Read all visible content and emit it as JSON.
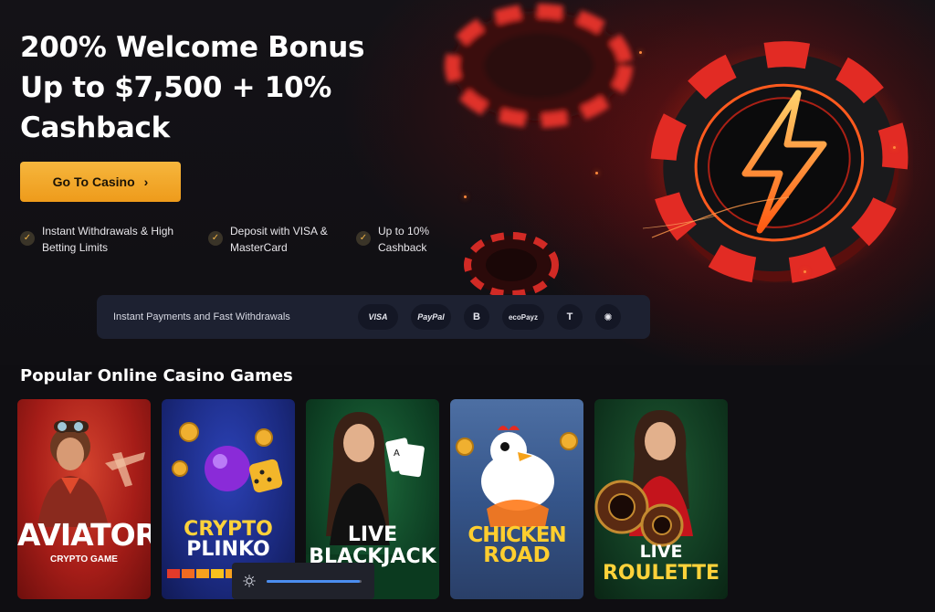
{
  "hero": {
    "title": "200% Welcome Bonus Up to $7,500 + 10% Cashback",
    "cta_label": "Go To Casino",
    "features": [
      "Instant Withdrawals & High Betting Limits",
      "Deposit with VISA & MasterCard",
      "Up to 10% Cashback"
    ]
  },
  "payments": {
    "label": "Instant Payments and Fast Withdrawals",
    "methods": [
      "VISA",
      "PayPal",
      "B",
      "ecoPayz",
      "T",
      "✺"
    ]
  },
  "games_section": {
    "title": "Popular Online Casino Games",
    "games": [
      {
        "name": "AVIATOR",
        "subtitle": "CRYPTO GAME"
      },
      {
        "name_line1": "CRYPTO",
        "name_line2": "PLINKO"
      },
      {
        "name_line1": "LIVE",
        "name_line2": "BLACKJACK"
      },
      {
        "name_line1": "CHICKEN",
        "name_line2": "ROAD"
      },
      {
        "name_line1": "LIVE",
        "name_line2": "ROULETTE"
      }
    ]
  },
  "brightness": {
    "level": 0.98
  },
  "colors": {
    "accent": "#f2a72a",
    "background": "#0f0e12",
    "payments_bar": "#1d2131"
  }
}
